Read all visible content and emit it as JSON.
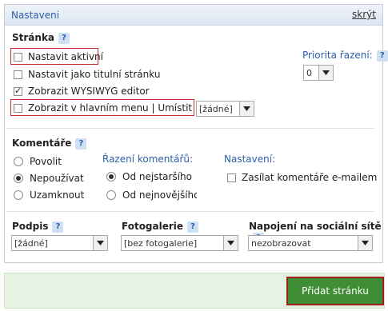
{
  "panel": {
    "title": "Nastaveni",
    "hide_link": "skrýt"
  },
  "page_section": {
    "title": "Stránka",
    "help": "?",
    "checkboxes": [
      {
        "label": "Nastavit aktivní",
        "checked": false
      },
      {
        "label": "Nastavit jako titulní stránku",
        "checked": false
      },
      {
        "label": "Zobrazit WYSIWYG editor",
        "checked": true
      },
      {
        "label": "Zobrazit v hlavním menu | Umístit pod",
        "checked": false
      }
    ],
    "menu_parent_select": "[žádné]",
    "priority_label": "Priorita řazení:",
    "priority_help": "?",
    "priority_value": "0"
  },
  "comments": {
    "title": "Komentáře",
    "help": "?",
    "options": [
      {
        "label": "Povolit",
        "selected": false
      },
      {
        "label": "Nepoužívat",
        "selected": true
      },
      {
        "label": "Uzamknout",
        "selected": false
      }
    ],
    "sort_label": "Řazení komentářů:",
    "sort_options": [
      {
        "label": "Od nejstaršího",
        "selected": true
      },
      {
        "label": "Od nejnovějšího",
        "selected": false
      }
    ],
    "settings_label": "Nastavení:",
    "email_label": "Zasílat komentáře e-mailem",
    "email_checked": false
  },
  "signature": {
    "label": "Podpis",
    "help": "?",
    "value": "[žádné]"
  },
  "gallery": {
    "label": "Fotogalerie",
    "help": "?",
    "value": "[bez fotogalerie]"
  },
  "social": {
    "label": "Napojení na sociální sítě",
    "help": "?",
    "value": "nezobrazovat"
  },
  "submit_label": "Přidat stránku",
  "colors": {
    "accent": "#2c5ea8",
    "submit_bg": "#3f8e35",
    "highlight": "#c9302c"
  }
}
